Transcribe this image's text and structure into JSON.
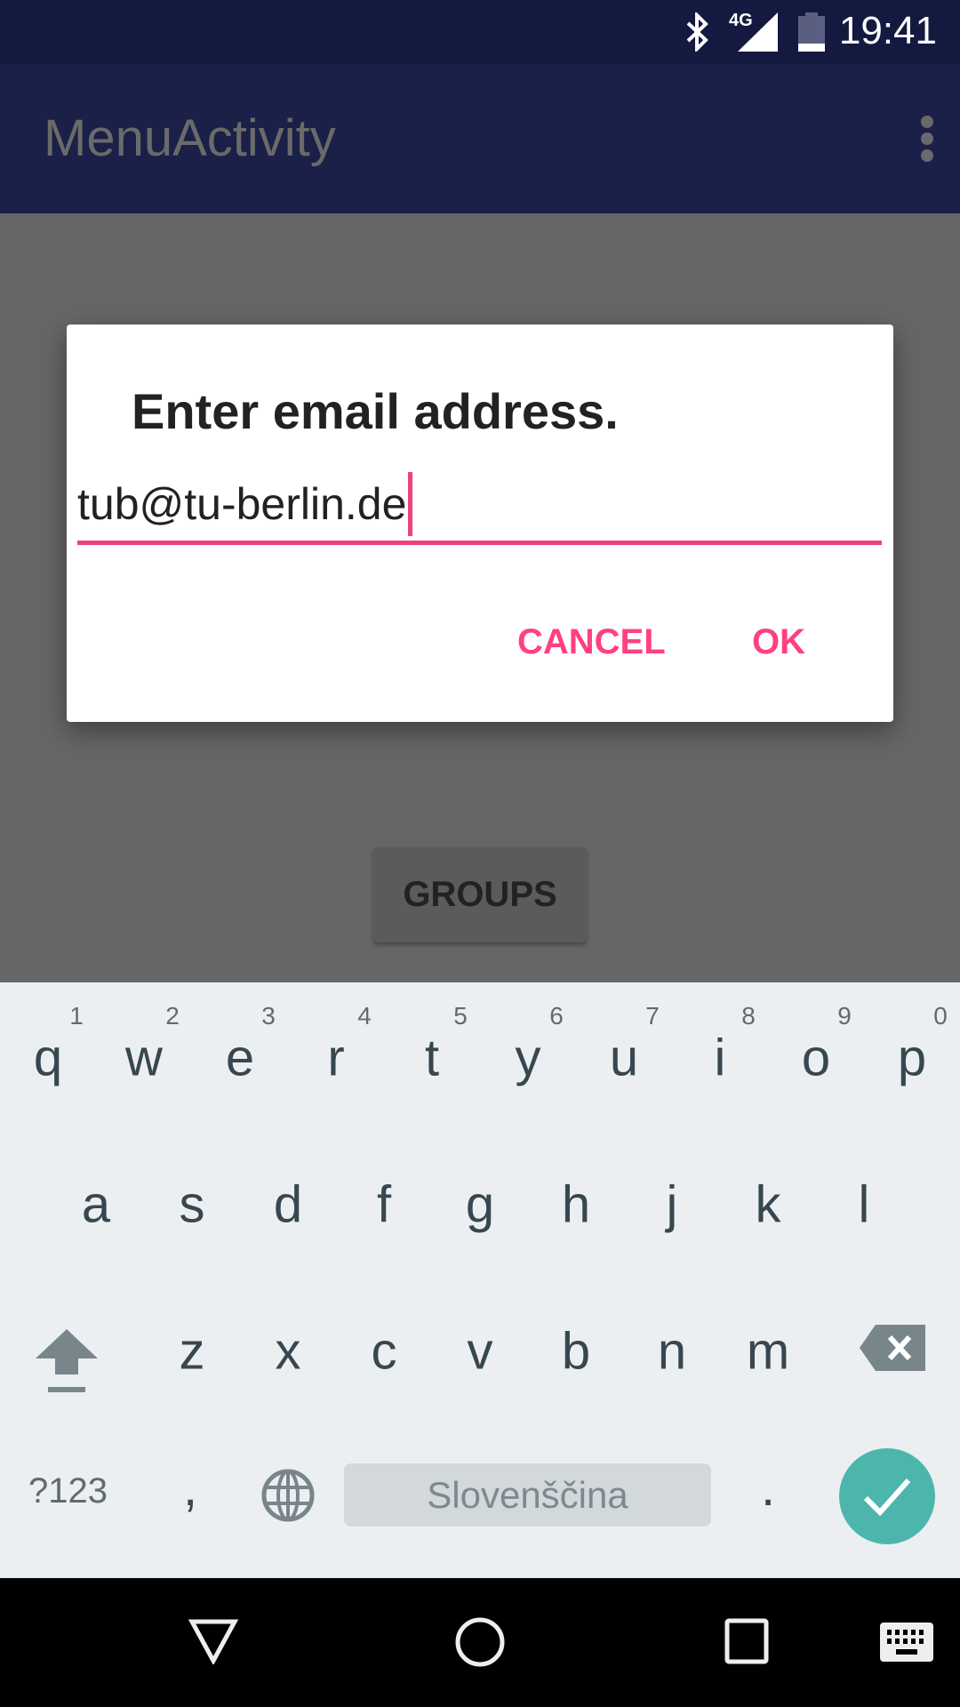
{
  "status_bar": {
    "time": "19:41",
    "network": "4G",
    "icons": [
      "bluetooth-icon",
      "signal-icon",
      "battery-icon"
    ]
  },
  "app_bar": {
    "title": "MenuActivity",
    "menu_icon": "more-vert-icon"
  },
  "main": {
    "groups_button": "GROUPS"
  },
  "dialog": {
    "title": "Enter email address.",
    "input_value": "tub@tu-berlin.de",
    "cancel": "CANCEL",
    "ok": "OK",
    "accent": "#ff4081"
  },
  "keyboard": {
    "row1": [
      "q",
      "w",
      "e",
      "r",
      "t",
      "y",
      "u",
      "i",
      "o",
      "p"
    ],
    "row1_hints": [
      "1",
      "2",
      "3",
      "4",
      "5",
      "6",
      "7",
      "8",
      "9",
      "0"
    ],
    "row2": [
      "a",
      "s",
      "d",
      "f",
      "g",
      "h",
      "j",
      "k",
      "l"
    ],
    "row3": [
      "z",
      "x",
      "c",
      "v",
      "b",
      "n",
      "m"
    ],
    "symbols": "?123",
    "comma": ",",
    "space": "Slovenščina",
    "period": ".",
    "enter_color": "#4db6ac"
  },
  "nav_bar": {
    "icons": [
      "back-icon",
      "home-icon",
      "recents-icon",
      "keyboard-icon"
    ]
  }
}
